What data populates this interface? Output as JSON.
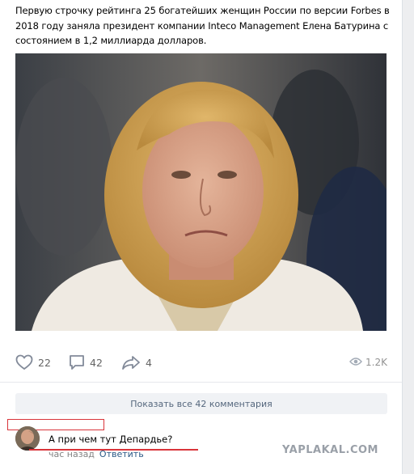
{
  "post": {
    "text": "Первую строчку рейтинга 25 богатейших женщин России по версии Forbes в 2018 году заняла президент компании Inteco Management Елена Батурина с состоянием в 1,2 миллиарда долларов."
  },
  "actions": {
    "likes": "22",
    "comments": "42",
    "shares": "4",
    "views": "1.2K"
  },
  "comments_section": {
    "show_all_label": "Показать все 42 комментария",
    "comment": {
      "text": "А при чем тут Депардье?",
      "time": "час назад",
      "reply_label": "Ответить"
    }
  },
  "watermark": {
    "text": "YAPLAKAL.COM"
  },
  "icons": {
    "like": "heart-icon",
    "comment": "speech-bubble-icon",
    "share": "share-arrow-icon",
    "views": "eye-icon"
  },
  "colors": {
    "link": "#2a5885",
    "muted": "#828282",
    "annotation": "#d9343a"
  }
}
